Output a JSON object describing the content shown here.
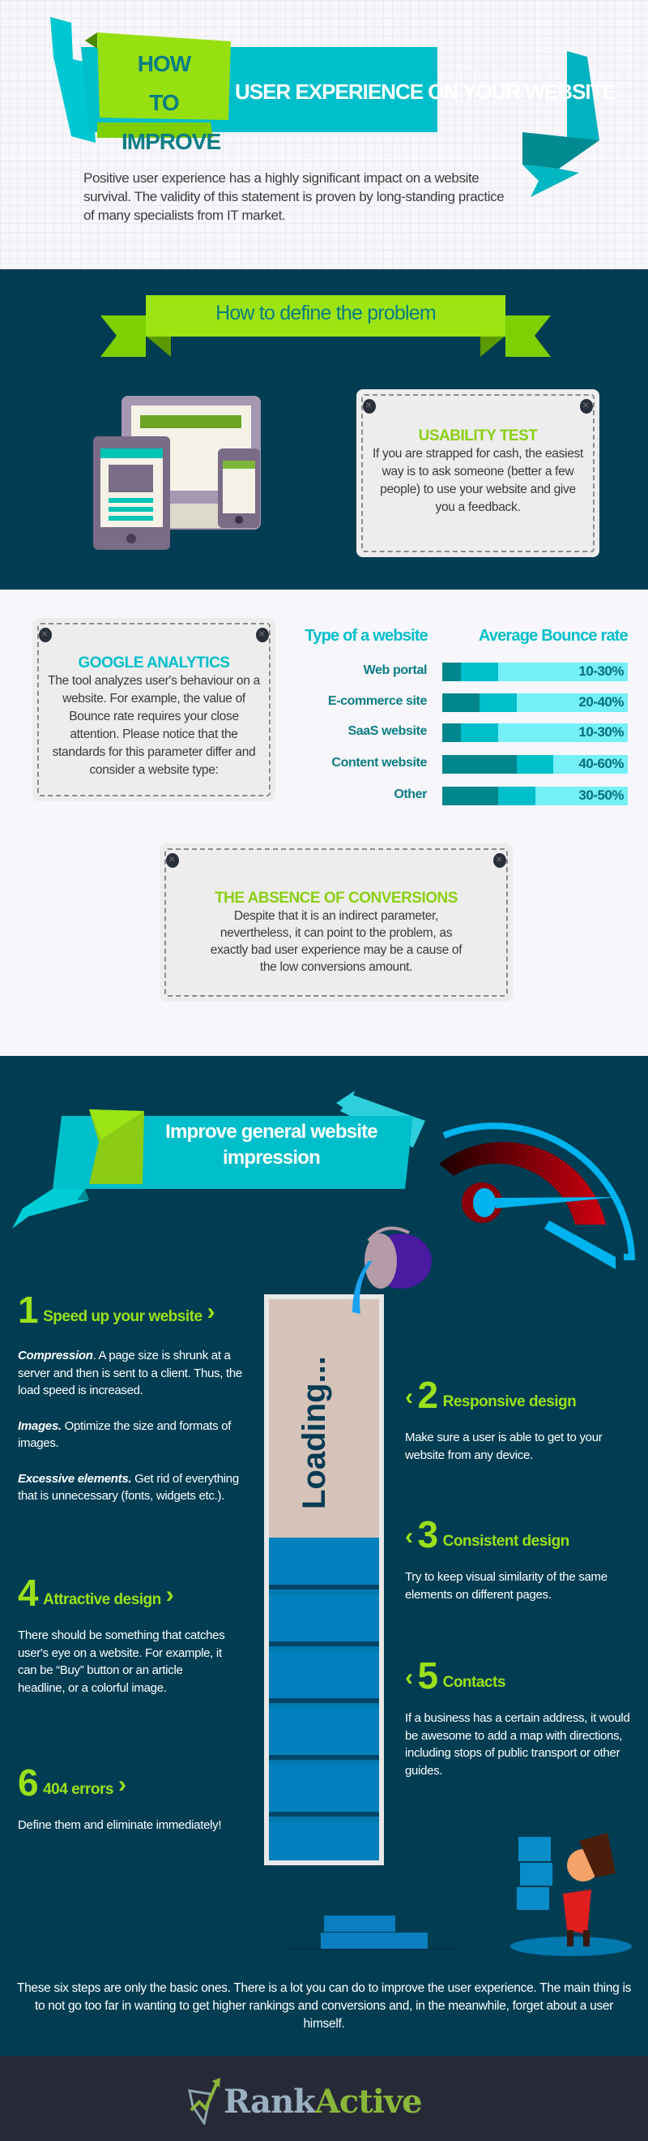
{
  "header": {
    "title_part1_line1": "HOW TO",
    "title_part1_line2": "IMPROVE",
    "title_part2": "USER EXPERIENCE ON YOUR WEBSITE",
    "intro": "Positive user experience has a highly significant impact on a website survival. The validity of this statement is proven by long-standing practice of many specialists from IT market."
  },
  "define": {
    "ribbon": "How to define the problem",
    "usability": {
      "title": "USABILITY TEST",
      "text": "If you are strapped for cash, the easiest way is to ask someone (better a few people) to use your website and give you a feedback."
    },
    "analytics": {
      "title": "GOOGLE ANALYTICS",
      "text": "The tool analyzes user's behaviour on a website. For example, the value of Bounce rate requires your close attention. Please notice that the standards for this parameter differ and consider a website type:"
    },
    "bounce_table": {
      "col1": "Type of a website",
      "col2": "Average Bounce rate",
      "rows": [
        {
          "type": "Web portal",
          "range": "10-30%",
          "low": 10,
          "high": 30
        },
        {
          "type": "E-commerce site",
          "range": "20-40%",
          "low": 20,
          "high": 40
        },
        {
          "type": "SaaS website",
          "range": "10-30%",
          "low": 10,
          "high": 30
        },
        {
          "type": "Content website",
          "range": "40-60%",
          "low": 40,
          "high": 60
        },
        {
          "type": "Other",
          "range": "30-50%",
          "low": 30,
          "high": 50
        }
      ]
    },
    "conversions": {
      "title": "THE ABSENCE OF CONVERSIONS",
      "text": "Despite that it is an indirect parameter, nevertheless, it can point to the problem, as exactly bad user experience may be a cause of the low conversions amount."
    }
  },
  "improve": {
    "ribbon": "Improve general website impression",
    "loading": "Loading...",
    "steps": [
      {
        "num": "1",
        "title": "Speed up your website",
        "paras": [
          {
            "bold": "Compression",
            "text": ". A page size is shrunk at a server and then is sent to a client. Thus, the load speed is increased."
          },
          {
            "bold": "Images.",
            "text": " Optimize the size and formats of images."
          },
          {
            "bold": "Excessive elements.",
            "text": " Get rid of everything that is unnecessary (fonts, widgets etc.)."
          }
        ]
      },
      {
        "num": "2",
        "title": "Responsive design",
        "text": "Make sure a user is able to get to your website from any device."
      },
      {
        "num": "3",
        "title": "Consistent design",
        "text": "Try to keep visual similarity of the same elements on different pages."
      },
      {
        "num": "4",
        "title": "Attractive design",
        "text": "There should be something that catches user's eye on a website. For example, it can be “Buy” button or an article headline, or a colorful image."
      },
      {
        "num": "5",
        "title": "Contacts",
        "text": "If a business has a certain address, it would be awesome to add a map with directions, including stops of public transport or other guides."
      },
      {
        "num": "6",
        "title": "404 errors",
        "text": "Define them and eliminate immediately!"
      }
    ],
    "closing": "These six steps are only the basic ones. There is a lot you can do to improve the user experience. The main thing is to not go too far in wanting to get higher rankings and conversions and, in the meanwhile, forget about a user himself."
  },
  "footer": {
    "logo_part1": "Rank",
    "logo_part2": "Active"
  },
  "colors": {
    "navy": "#003d52",
    "cyan": "#00bfcb",
    "green": "#9be01a",
    "footer": "#272a36"
  }
}
